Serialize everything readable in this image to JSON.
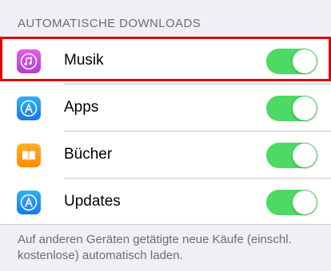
{
  "section": {
    "header": "AUTOMATISCHE DOWNLOADS"
  },
  "rows": [
    {
      "label": "Musik",
      "icon": "music-icon",
      "toggle_on": true,
      "highlighted": true
    },
    {
      "label": "Apps",
      "icon": "app-store-icon",
      "toggle_on": true
    },
    {
      "label": "Bücher",
      "icon": "ibooks-icon",
      "toggle_on": true
    },
    {
      "label": "Updates",
      "icon": "app-store-icon",
      "toggle_on": true
    }
  ],
  "footer": {
    "text": "Auf anderen Geräten getätigte neue Käufe (einschl. kostenlose) automatisch laden."
  },
  "colors": {
    "toggle_on": "#4cd964",
    "highlight": "#e20000",
    "music_icon": "#c74cdb",
    "app_store_icon": "#1a90f0",
    "ibooks_icon": "#ff9500"
  }
}
